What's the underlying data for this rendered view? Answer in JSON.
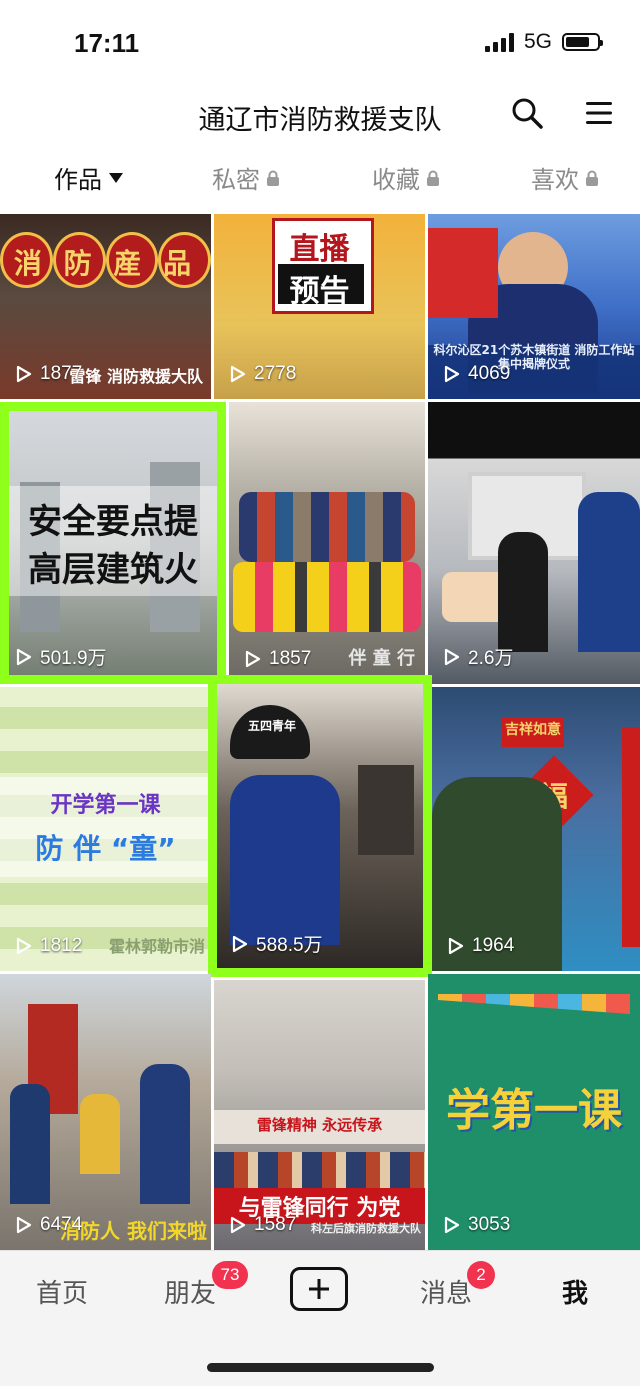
{
  "status_bar": {
    "time": "17:11",
    "network": "5G",
    "battery_level": 0.75
  },
  "header": {
    "title": "通辽市消防救援支队"
  },
  "tabs": [
    {
      "label": "作品",
      "active": true
    },
    {
      "label": "私密",
      "locked": true
    },
    {
      "label": "收藏",
      "locked": true
    },
    {
      "label": "喜欢",
      "locked": true
    }
  ],
  "videos": [
    {
      "views": "1877",
      "overlay": "消 防 産 品",
      "bottom_text": "雷锋 消防救援大队"
    },
    {
      "views": "2778",
      "overlay_top": "直播",
      "overlay_bottom": "预告"
    },
    {
      "views": "4069",
      "caption": "科尔沁区21个苏木镇街道 消防工作站集中揭牌仪式"
    },
    {
      "views": "501.9万",
      "overlay_line1": "安全要点提",
      "overlay_line2": "高层建筑火"
    },
    {
      "views": "1857",
      "bottom_text": "伴 童 行"
    },
    {
      "views": "2.6万"
    },
    {
      "views": "1812",
      "overlay_line1": "开学第一课",
      "overlay_line2": "防 伴 “童”",
      "bottom_text": "霍林郭勒市消"
    },
    {
      "views": "588.5万",
      "helmet_text": "五四青年"
    },
    {
      "views": "1964",
      "sign": "吉祥如意",
      "fu": "福"
    },
    {
      "views": "6474",
      "bottom_text": "消防人 我们来啦"
    },
    {
      "views": "1587",
      "banner_top": "雷锋精神 永远传承",
      "banner_bottom": "与雷锋同行 为党",
      "credit": "科左后旗消防救援大队"
    },
    {
      "views": "3053",
      "overlay": "学第一课"
    }
  ],
  "bottom_nav": {
    "home": "首页",
    "friends": "朋友",
    "friends_badge": "73",
    "messages": "消息",
    "messages_badge": "2",
    "me": "我"
  },
  "colors": {
    "highlight": "#8fff1c",
    "badge": "#f2334f"
  }
}
